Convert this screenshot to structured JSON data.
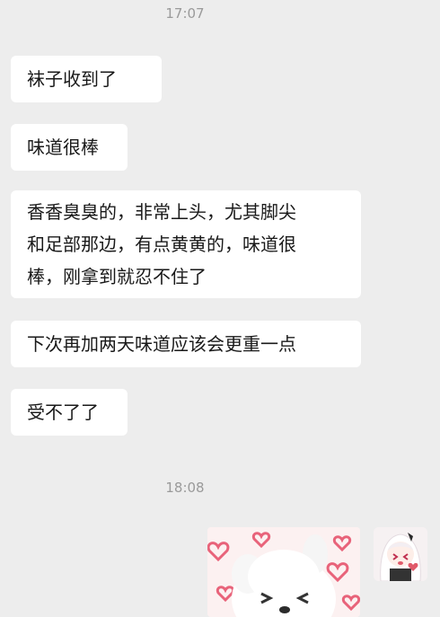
{
  "chat": {
    "timestamps": [
      "17:07",
      "18:08"
    ],
    "messages": [
      {
        "lines": [
          "袜子收到了"
        ]
      },
      {
        "lines": [
          "味道很棒"
        ]
      },
      {
        "lines": [
          "香香臭臭的，非常上头，尤其脚尖",
          "和足部那边，有点黄黄的，味道很",
          "棒，刚拿到就忍不住了"
        ]
      },
      {
        "lines": [
          "下次再加两天味道应该会更重一点"
        ]
      },
      {
        "lines": [
          "受不了了"
        ]
      }
    ],
    "sent": {
      "sticker_icon": "dog-hearts-sticker",
      "avatar_icon": "anime-avatar"
    }
  }
}
